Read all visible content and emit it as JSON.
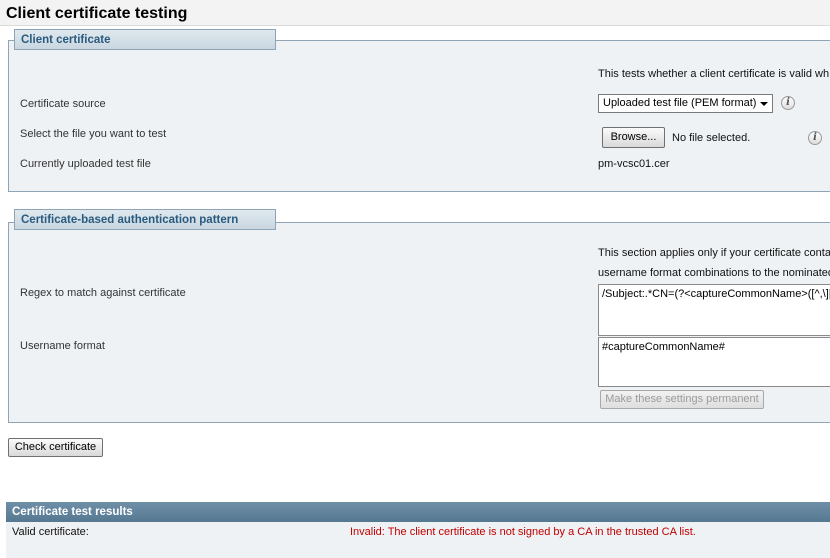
{
  "page": {
    "title": "Client certificate testing"
  },
  "client_certificate": {
    "legend": "Client certificate",
    "intro": "This tests whether a client certificate is valid wh",
    "certificate_source_label": "Certificate source",
    "certificate_source_value": "Uploaded test file (PEM format)",
    "select_file_label": "Select the file you want to test",
    "browse_label": "Browse...",
    "file_status": "No file selected.",
    "current_file_label": "Currently uploaded test file",
    "current_file_value": "pm-vcsc01.cer"
  },
  "auth_pattern": {
    "legend": "Certificate-based authentication pattern",
    "intro_line1": "This section applies only if your certificate conta",
    "intro_line2": "username format combinations to the nominated",
    "regex_label": "Regex to match against certificate",
    "regex_value": "/Subject:.*CN=(?<captureCommonName>([^,\\]|(\\",
    "username_label": "Username format",
    "username_value": "#captureCommonName#",
    "make_permanent_label": "Make these settings permanent"
  },
  "actions": {
    "check_certificate_label": "Check certificate"
  },
  "results": {
    "header": "Certificate test results",
    "valid_label": "Valid certificate:",
    "valid_value": "Invalid: The client certificate is not signed by a CA in the trusted CA list.",
    "error_color": "#c00000"
  },
  "icons": {
    "info": "info-icon",
    "dropdown": "chevron-down-icon"
  }
}
